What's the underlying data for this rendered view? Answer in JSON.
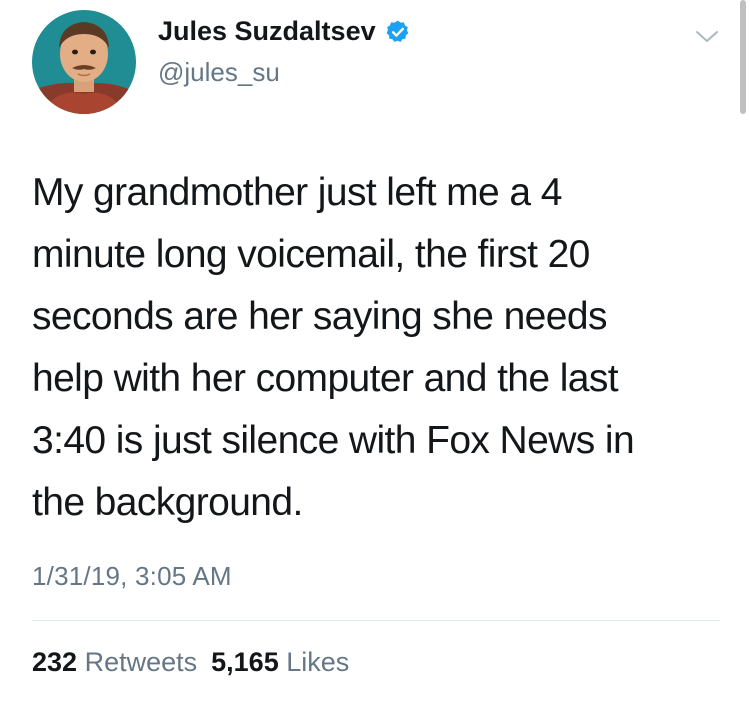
{
  "author": {
    "name": "Jules Suzdaltsev",
    "handle": "@jules_su",
    "verified": true,
    "avatar_icon": "profile-photo"
  },
  "tweet": {
    "text_lines": [
      "My grandmother just left me a 4",
      "minute long voicemail, the first 20",
      "seconds are her saying she needs",
      "help with her computer and the last",
      "3:40 is just silence with Fox News in",
      "the background."
    ],
    "timestamp": "1/31/19, 3:05 AM"
  },
  "stats": {
    "retweets_count": "232",
    "retweets_label": "Retweets",
    "likes_count": "5,165",
    "likes_label": "Likes"
  },
  "icons": {
    "verified": "verified-badge-icon",
    "menu": "chevron-down-icon"
  },
  "colors": {
    "verified_blue": "#1da1f2",
    "secondary_text": "#657786",
    "primary_text": "#14171a",
    "divider": "#e1e8ed"
  }
}
